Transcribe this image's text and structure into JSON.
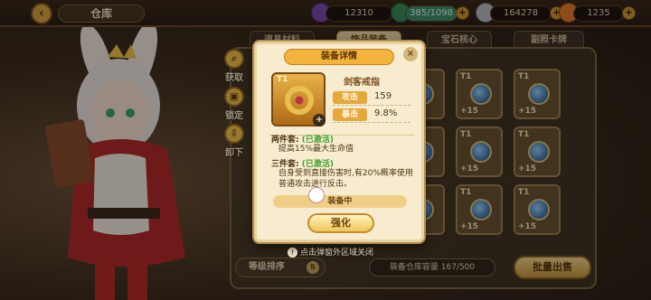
{
  "topbar": {
    "title": "仓库",
    "currency_a": "12310",
    "currency_b": "385/1098",
    "currency_c": "164278",
    "currency_d": "1235",
    "icons": [
      "back-arrow-icon",
      "candy-icon",
      "energy-icon",
      "coin-icon",
      "carrot-icon"
    ]
  },
  "tabs": [
    {
      "label": "道具材料",
      "active": false
    },
    {
      "label": "饰品装备",
      "active": true
    },
    {
      "label": "宝石核心",
      "active": false
    },
    {
      "label": "副照卡牌",
      "active": false
    }
  ],
  "side_actions": [
    {
      "label": "获取",
      "icon": "search-icon"
    },
    {
      "label": "锁定",
      "icon": "lock-icon"
    },
    {
      "label": "卸下",
      "icon": "unequip-icon"
    }
  ],
  "dialog": {
    "title": "装备详情",
    "tier": "T1",
    "item_name": "剑客戒指",
    "stats": [
      {
        "label": "攻击",
        "value": "159"
      },
      {
        "label": "暴击",
        "value": "9.8%"
      }
    ],
    "set2_title": "两件套:",
    "set2_status": "(已激活)",
    "set2_desc": "提高15%最大生命值",
    "set3_title": "三件套:",
    "set3_status": "(已激活)",
    "set3_desc": "自身受到直接伤害时,有20%概率使用普通攻击进行反击。",
    "equipped_label": "装备中",
    "upgrade_label": "强化"
  },
  "grid": {
    "tier_label": "T1",
    "level_label": "+15"
  },
  "bottom": {
    "sort_label": "等级排序",
    "capacity_label": "装备仓库容量",
    "capacity_value": "167/500",
    "sell_label": "批量出售",
    "hint": "点击弹窗外区域关闭"
  }
}
